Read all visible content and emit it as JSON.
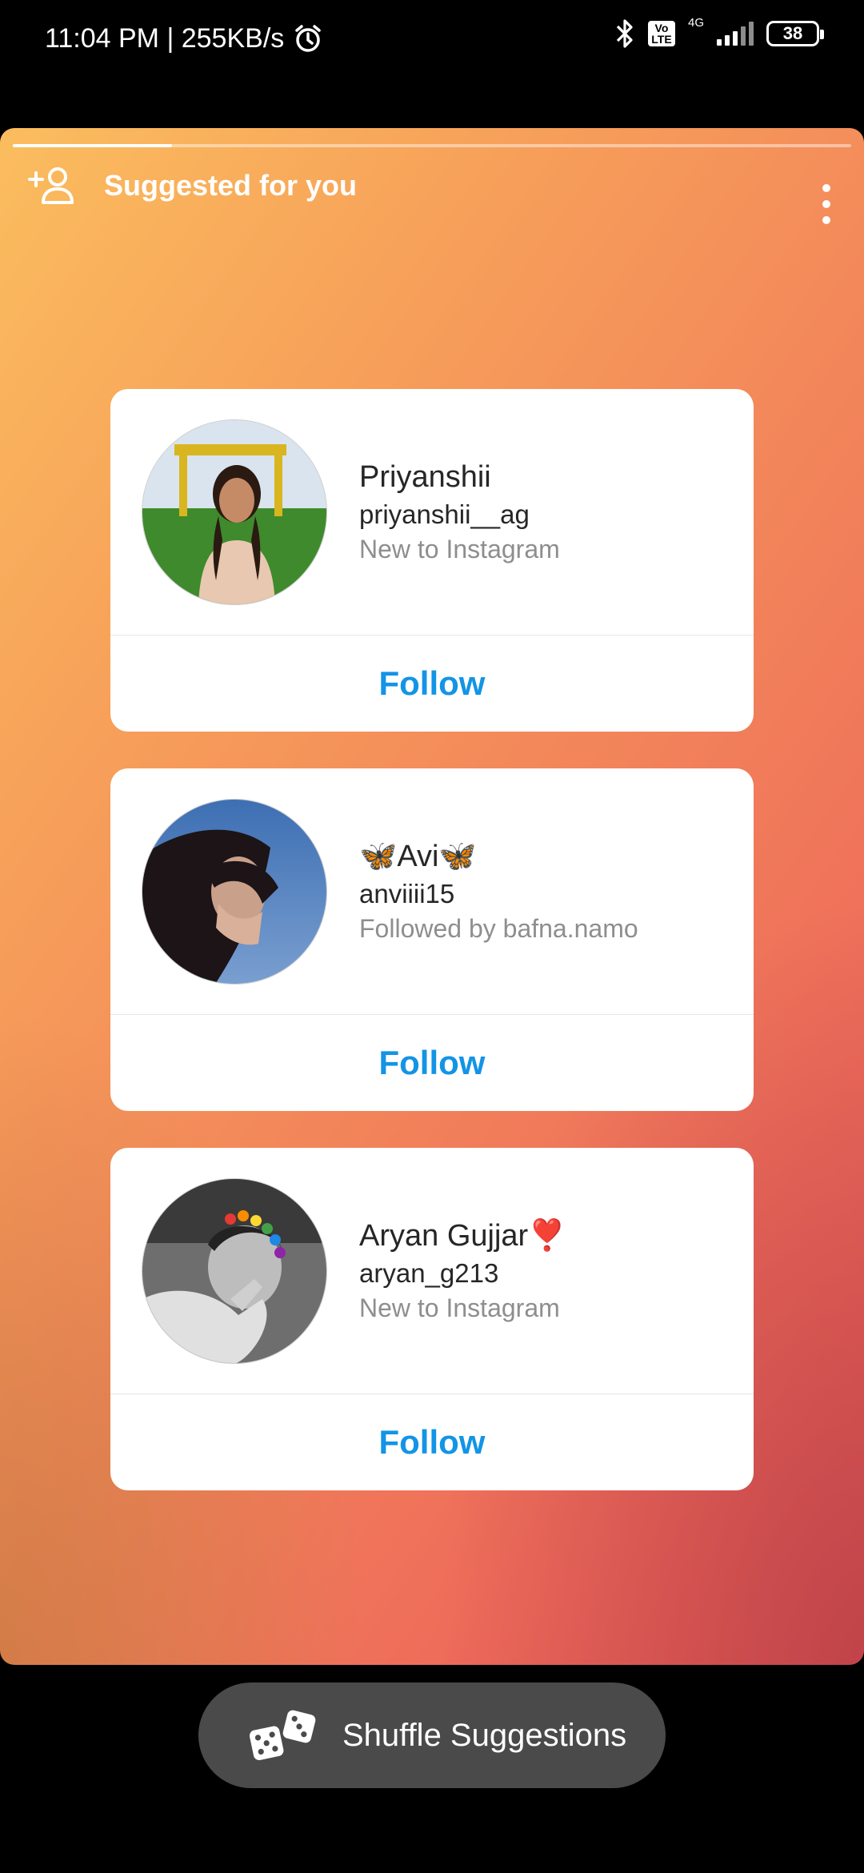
{
  "status_bar": {
    "time_speed": "11:04 PM | 255KB/s",
    "volte": "Vo LTE",
    "network": "4G",
    "battery": "38"
  },
  "story": {
    "title": "Suggested for you",
    "progress_fraction": 0.19
  },
  "suggestions": [
    {
      "display_name": "Priyanshii",
      "username": "priyanshii__ag",
      "subtitle": "New to Instagram",
      "follow_label": "Follow"
    },
    {
      "display_name": "🦋Avi🦋",
      "username": "anviiii15",
      "subtitle": "Followed by bafna.namo",
      "follow_label": "Follow"
    },
    {
      "display_name": "Aryan Gujjar❣️",
      "username": "aryan_g213",
      "subtitle": "New to Instagram",
      "follow_label": "Follow"
    }
  ],
  "shuffle": {
    "label": "Shuffle Suggestions"
  },
  "colors": {
    "follow_blue": "#1394e6",
    "gradient_start": "#fbbd5e",
    "gradient_end": "#e45a55"
  }
}
